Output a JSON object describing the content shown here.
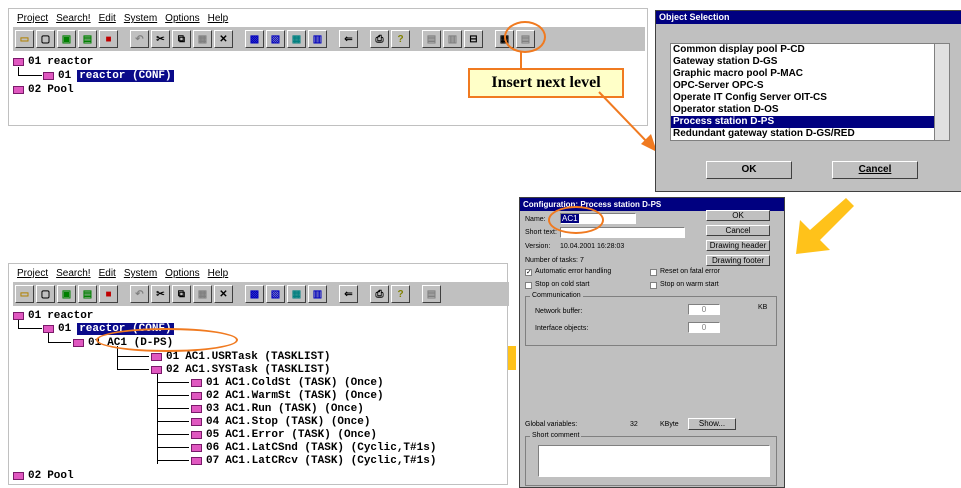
{
  "menu": [
    "Project",
    "Search!",
    "Edit",
    "System",
    "Options",
    "Help"
  ],
  "tooltip": "Insert next level",
  "tree_top": [
    {
      "num": "01",
      "label": "reactor",
      "selected": false
    },
    {
      "num": "01",
      "label": "reactor (CONF)",
      "selected": true
    },
    {
      "num": "02",
      "label": "Pool",
      "selected": false
    }
  ],
  "object_selection": {
    "title": "Object Selection",
    "items": [
      "Common display pool P-CD",
      "Gateway station D-GS",
      "Graphic macro  pool P-MAC",
      "OPC-Server OPC-S",
      "Operate IT Config Server OIT-CS",
      "Operator station D-OS",
      "Process station D-PS",
      "Redundant gateway station D-GS/RED"
    ],
    "selected_index": 6,
    "ok": "OK",
    "cancel": "Cancel"
  },
  "config": {
    "title": "Configuration: Process station D-PS",
    "name_label": "Name:",
    "name_value": "AC1",
    "short_text_label": "Short text:",
    "version_label": "Version:",
    "version_value": "10.04.2001 16:28:03",
    "num_tasks_label": "Number of tasks:",
    "num_tasks_value": "7",
    "auto_error": "Automatic error handling",
    "reset_fatal": "Reset on fatal error",
    "stop_cold": "Stop on cold start",
    "stop_warm": "Stop on warm start",
    "communication": "Communication",
    "network_buffer": "Network buffer:",
    "network_value": "0",
    "kb": "KB",
    "interface_objects": "Interface objects:",
    "interface_value": "0",
    "global_vars": "Global variables:",
    "global_value": "32",
    "kbyte": "KByte",
    "show": "Show...",
    "short_comment": "Short comment",
    "ok": "OK",
    "cancel": "Cancel",
    "drawing_header": "Drawing header",
    "drawing_footer": "Drawing footer"
  },
  "tree_bottom": [
    {
      "num": "01",
      "label": "reactor"
    },
    {
      "num": "01",
      "label": "reactor (CONF)"
    },
    {
      "num": "01",
      "label": "AC1  (D-PS)"
    },
    {
      "num": "01",
      "label": "AC1.USRTask  (TASKLIST)"
    },
    {
      "num": "02",
      "label": "AC1.SYSTask  (TASKLIST)"
    },
    {
      "num": "01",
      "label": "AC1.ColdSt  (TASK) (Once)"
    },
    {
      "num": "02",
      "label": "AC1.WarmSt  (TASK) (Once)"
    },
    {
      "num": "03",
      "label": "AC1.Run  (TASK) (Once)"
    },
    {
      "num": "04",
      "label": "AC1.Stop  (TASK) (Once)"
    },
    {
      "num": "05",
      "label": "AC1.Error  (TASK) (Once)"
    },
    {
      "num": "06",
      "label": "AC1.LatCSnd  (TASK) (Cyclic,T#1s)"
    },
    {
      "num": "07",
      "label": "AC1.LatCRcv  (TASK) (Cyclic,T#1s)"
    },
    {
      "num": "02",
      "label": "Pool"
    }
  ],
  "colors": {
    "accent_orange": "#f07a20",
    "arrow_yellow": "#ffc21a",
    "tooltip_bg": "#ffffc8",
    "selection": "#0a0a8a",
    "node_pink": "#e058c0"
  }
}
